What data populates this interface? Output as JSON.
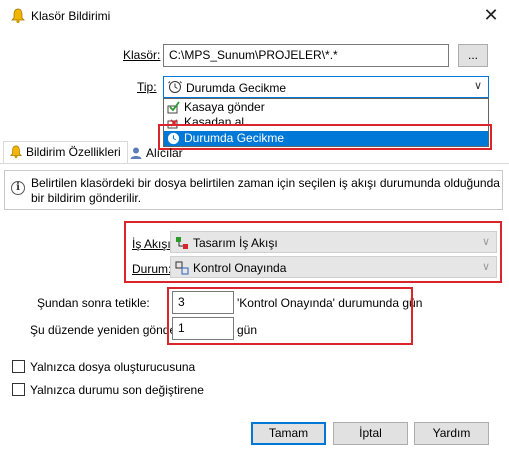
{
  "window": {
    "title": "Klasör Bildirimi",
    "close_glyph": "✕"
  },
  "form": {
    "klasor_label": "Klasör:",
    "klasor_value": "C:\\MPS_Sunum\\PROJELER\\*.*",
    "browse_label": "...",
    "tip_label": "Tip:",
    "tip_selected": "Durumda Gecikme"
  },
  "dropdown": {
    "items": [
      {
        "label": "Kasaya gönder",
        "icon": "check-in-icon"
      },
      {
        "label": "Kasadan al",
        "icon": "check-out-icon"
      },
      {
        "label": "Durumda Gecikme",
        "icon": "delay-clock-icon",
        "selected": true
      }
    ]
  },
  "tabs": [
    {
      "label": "Bildirim Özellikleri",
      "icon": "bell-icon",
      "active": true
    },
    {
      "label": "Alıcılar",
      "icon": "user-icon",
      "active": false
    }
  ],
  "info": {
    "text": "Belirtilen klasördeki bir dosya belirtilen zaman için seçilen iş akışı durumunda olduğunda bir bildirim gönderilir."
  },
  "workflow": {
    "is_akisi_label": "İş Akışı:",
    "is_akisi_value": "Tasarım İş Akışı",
    "durum_label": "Durum:",
    "durum_value": "Kontrol Onayında"
  },
  "trigger": {
    "after_label": "Şundan sonra tetikle:",
    "after_value": "3",
    "after_suffix": "'Kontrol Onayında' durumunda gün",
    "repeat_label": "Şu düzende yeniden gönder:",
    "repeat_value": "1",
    "repeat_suffix": "gün"
  },
  "options": {
    "only_creator": "Yalnızca dosya oluşturucusuna",
    "only_last_changer": "Yalnızca durumu son değiştirene"
  },
  "buttons": {
    "ok": "Tamam",
    "cancel": "İptal",
    "help": "Yardım"
  },
  "colors": {
    "accent": "#0078d7",
    "highlight_frame": "#d9262b"
  }
}
